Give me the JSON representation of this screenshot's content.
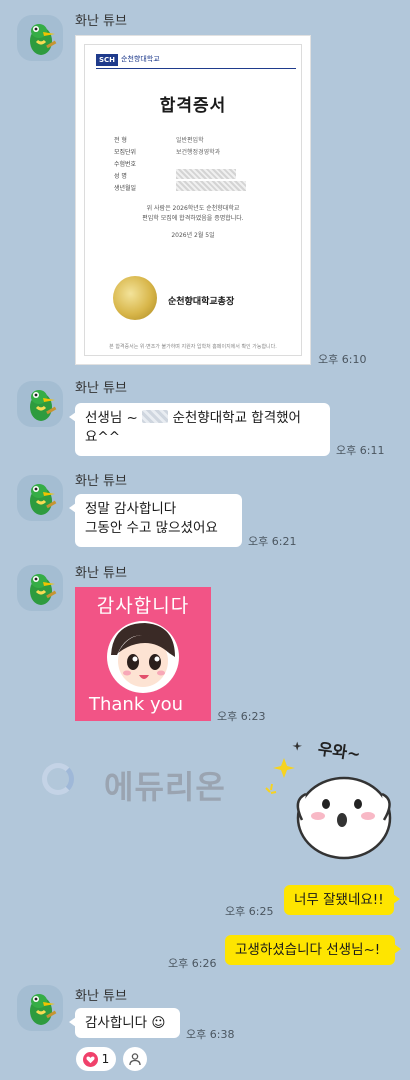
{
  "colors": {
    "background": "#b2c7da",
    "bubble_incoming": "#ffffff",
    "bubble_outgoing": "#fee500",
    "sticker_pink": "#f25486"
  },
  "messages": {
    "m1": {
      "sender": "화난 튜브",
      "time": "오후 6:10"
    },
    "m2": {
      "sender": "화난 튜브",
      "text_prefix": "선생님 ~",
      "text_suffix": "순천향대학교 합격했어",
      "text_line2": "요^^",
      "time": "오후 6:11"
    },
    "m3": {
      "sender": "화난 튜브",
      "line1": "정말 감사합니다",
      "line2": "그동안 수고 많으셨어요",
      "time": "오후 6:21"
    },
    "m4": {
      "sender": "화난 튜브",
      "time": "오후 6:23"
    },
    "m5": {
      "time": "오후 6:25",
      "text": "너무 잘됐네요!!"
    },
    "m6": {
      "time": "오후 6:26",
      "text": "고생하셨습니다 선생님~!"
    },
    "m7": {
      "sender": "화난 튜브",
      "text": "감사합니다 ☺",
      "time": "오후 6:38"
    }
  },
  "certificate": {
    "logo_mark": "SCH",
    "logo_text": "순천향대학교",
    "title": "합격증서",
    "fields": [
      {
        "label": "전    형",
        "value": "일반편입학"
      },
      {
        "label": "모집단위",
        "value": "보건행정경영학과"
      },
      {
        "label": "수험번호",
        "value": ""
      },
      {
        "label": "성    명",
        "value": ""
      },
      {
        "label": "생년월일",
        "value": ""
      }
    ],
    "body_line1": "위 사람은 2026학년도 순천향대학교",
    "body_line2": "편입학 모집에 합격하였음을 증명합니다.",
    "date": "2026년 2월 5일",
    "president": "순천향대학교총장",
    "footer": "본 합격증서는 위·변조가 불가하며 지원자 입학처 홈페이지에서 확인 가능합니다."
  },
  "sticker_thanks": {
    "korean": "감사합니다",
    "english": "Thank you"
  },
  "emoticon": {
    "exclaim": "우와~"
  },
  "watermark": {
    "text": "에듀리온"
  },
  "reactions": {
    "heart_count": "1"
  }
}
